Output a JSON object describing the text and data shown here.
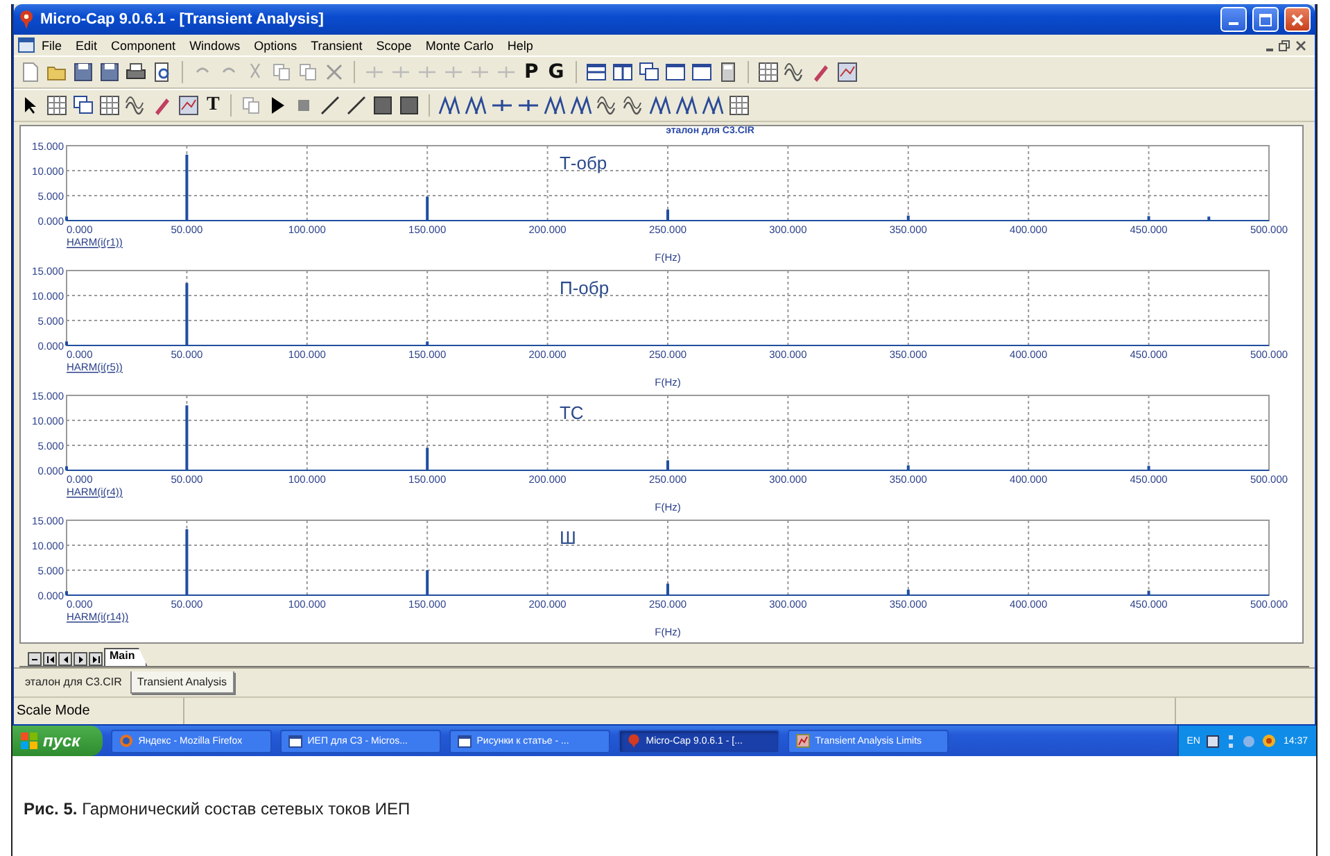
{
  "window": {
    "title": "Micro-Cap 9.0.6.1 - [Transient Analysis]"
  },
  "menu": [
    "File",
    "Edit",
    "Component",
    "Windows",
    "Options",
    "Transient",
    "Scope",
    "Monte Carlo",
    "Help"
  ],
  "toolbar": {
    "letters": [
      "P",
      "G"
    ]
  },
  "toolbar_2": {
    "letters": [
      "T"
    ]
  },
  "plot_header": "эталон для C3.CIR",
  "plots": [
    {
      "chart_data": {
        "type": "bar",
        "title": "Т-обр",
        "xlabel": "F(Hz)",
        "x": [
          0,
          50,
          150,
          250,
          350,
          450,
          475
        ],
        "series": [
          {
            "name": "HARM(i(r1))",
            "color": "#1f4fa0",
            "values": [
              0.8,
              13.2,
              4.8,
              2.2,
              1.0,
              0.9,
              0.8
            ]
          }
        ],
        "grid": true,
        "xlim": [
          0,
          500
        ],
        "ylim": [
          0,
          15
        ],
        "xticks": [
          {
            "value": 0,
            "label": "0.000"
          },
          {
            "value": 50,
            "label": "50.000"
          },
          {
            "value": 100,
            "label": "100.000"
          },
          {
            "value": 150,
            "label": "150.000"
          },
          {
            "value": 200,
            "label": "200.000"
          },
          {
            "value": 250,
            "label": "250.000"
          },
          {
            "value": 300,
            "label": "300.000"
          },
          {
            "value": 350,
            "label": "350.000"
          },
          {
            "value": 400,
            "label": "400.000"
          },
          {
            "value": 450,
            "label": "450.000"
          },
          {
            "value": 500,
            "label": "500.000"
          }
        ],
        "yticks": [
          {
            "value": 0,
            "label": "0.000"
          },
          {
            "value": 5,
            "label": "5.000"
          },
          {
            "value": 10,
            "label": "10.000"
          },
          {
            "value": 15,
            "label": "15.000"
          }
        ]
      }
    },
    {
      "chart_data": {
        "type": "bar",
        "title": "П-обр",
        "xlabel": "F(Hz)",
        "x": [
          0,
          50,
          150
        ],
        "series": [
          {
            "name": "HARM(i(r5))",
            "color": "#1f4fa0",
            "values": [
              0.8,
              12.5,
              0.8
            ]
          }
        ],
        "grid": true,
        "xlim": [
          0,
          500
        ],
        "ylim": [
          0,
          15
        ],
        "xticks": [
          {
            "value": 0,
            "label": "0.000"
          },
          {
            "value": 50,
            "label": "50.000"
          },
          {
            "value": 100,
            "label": "100.000"
          },
          {
            "value": 150,
            "label": "150.000"
          },
          {
            "value": 200,
            "label": "200.000"
          },
          {
            "value": 250,
            "label": "250.000"
          },
          {
            "value": 300,
            "label": "300.000"
          },
          {
            "value": 350,
            "label": "350.000"
          },
          {
            "value": 400,
            "label": "400.000"
          },
          {
            "value": 450,
            "label": "450.000"
          },
          {
            "value": 500,
            "label": "500.000"
          }
        ],
        "yticks": [
          {
            "value": 0,
            "label": "0.000"
          },
          {
            "value": 5,
            "label": "5.000"
          },
          {
            "value": 10,
            "label": "10.000"
          },
          {
            "value": 15,
            "label": "15.000"
          }
        ]
      }
    },
    {
      "chart_data": {
        "type": "bar",
        "title": "ТС",
        "xlabel": "F(Hz)",
        "x": [
          0,
          50,
          150,
          250,
          350,
          450
        ],
        "series": [
          {
            "name": "HARM(i(r4))",
            "color": "#1f4fa0",
            "values": [
              0.8,
              13.0,
              4.5,
              2.0,
              1.0,
              0.9
            ]
          }
        ],
        "grid": true,
        "xlim": [
          0,
          500
        ],
        "ylim": [
          0,
          15
        ],
        "xticks": [
          {
            "value": 0,
            "label": "0.000"
          },
          {
            "value": 50,
            "label": "50.000"
          },
          {
            "value": 100,
            "label": "100.000"
          },
          {
            "value": 150,
            "label": "150.000"
          },
          {
            "value": 200,
            "label": "200.000"
          },
          {
            "value": 250,
            "label": "250.000"
          },
          {
            "value": 300,
            "label": "300.000"
          },
          {
            "value": 350,
            "label": "350.000"
          },
          {
            "value": 400,
            "label": "400.000"
          },
          {
            "value": 450,
            "label": "450.000"
          },
          {
            "value": 500,
            "label": "500.000"
          }
        ],
        "yticks": [
          {
            "value": 0,
            "label": "0.000"
          },
          {
            "value": 5,
            "label": "5.000"
          },
          {
            "value": 10,
            "label": "10.000"
          },
          {
            "value": 15,
            "label": "15.000"
          }
        ]
      }
    },
    {
      "chart_data": {
        "type": "bar",
        "title": "Ш",
        "xlabel": "F(Hz)",
        "x": [
          0,
          50,
          150,
          250,
          350,
          450
        ],
        "series": [
          {
            "name": "HARM(i(r14))",
            "color": "#1f4fa0",
            "values": [
              0.8,
              13.2,
              5.0,
              2.3,
              1.1,
              0.9
            ]
          }
        ],
        "grid": true,
        "xlim": [
          0,
          500
        ],
        "ylim": [
          0,
          15
        ],
        "xticks": [
          {
            "value": 0,
            "label": "0.000"
          },
          {
            "value": 50,
            "label": "50.000"
          },
          {
            "value": 100,
            "label": "100.000"
          },
          {
            "value": 150,
            "label": "150.000"
          },
          {
            "value": 200,
            "label": "200.000"
          },
          {
            "value": 250,
            "label": "250.000"
          },
          {
            "value": 300,
            "label": "300.000"
          },
          {
            "value": 350,
            "label": "350.000"
          },
          {
            "value": 400,
            "label": "400.000"
          },
          {
            "value": 450,
            "label": "450.000"
          },
          {
            "value": 500,
            "label": "500.000"
          }
        ],
        "yticks": [
          {
            "value": 0,
            "label": "0.000"
          },
          {
            "value": 5,
            "label": "5.000"
          },
          {
            "value": 10,
            "label": "10.000"
          },
          {
            "value": 15,
            "label": "15.000"
          }
        ]
      }
    }
  ],
  "sheet_tabs": [
    {
      "label": "Main",
      "selected": true
    }
  ],
  "document_tabs": [
    {
      "label": "эталон для C3.CIR",
      "selected": false
    },
    {
      "label": "Transient Analysis",
      "selected": true
    }
  ],
  "status_bar": "Scale Mode",
  "taskbar": {
    "start": "пуск",
    "items": [
      {
        "label": "Яндекс - Mozilla Firefox",
        "kind": "browser",
        "selected": false
      },
      {
        "label": "ИЕП для C3 - Micros...",
        "kind": "document",
        "selected": false
      },
      {
        "label": "Рисунки к статье - ...",
        "kind": "document",
        "selected": false
      },
      {
        "label": "Micro-Cap 9.0.6.1 - [...",
        "kind": "app",
        "selected": true
      },
      {
        "label": "Transient Analysis Limits",
        "kind": "chart",
        "selected": false
      }
    ],
    "language": "EN",
    "clock": "14:37"
  },
  "caption": "**Рис. 5.** Гармонический состав сетевых токов ИЕП"
}
